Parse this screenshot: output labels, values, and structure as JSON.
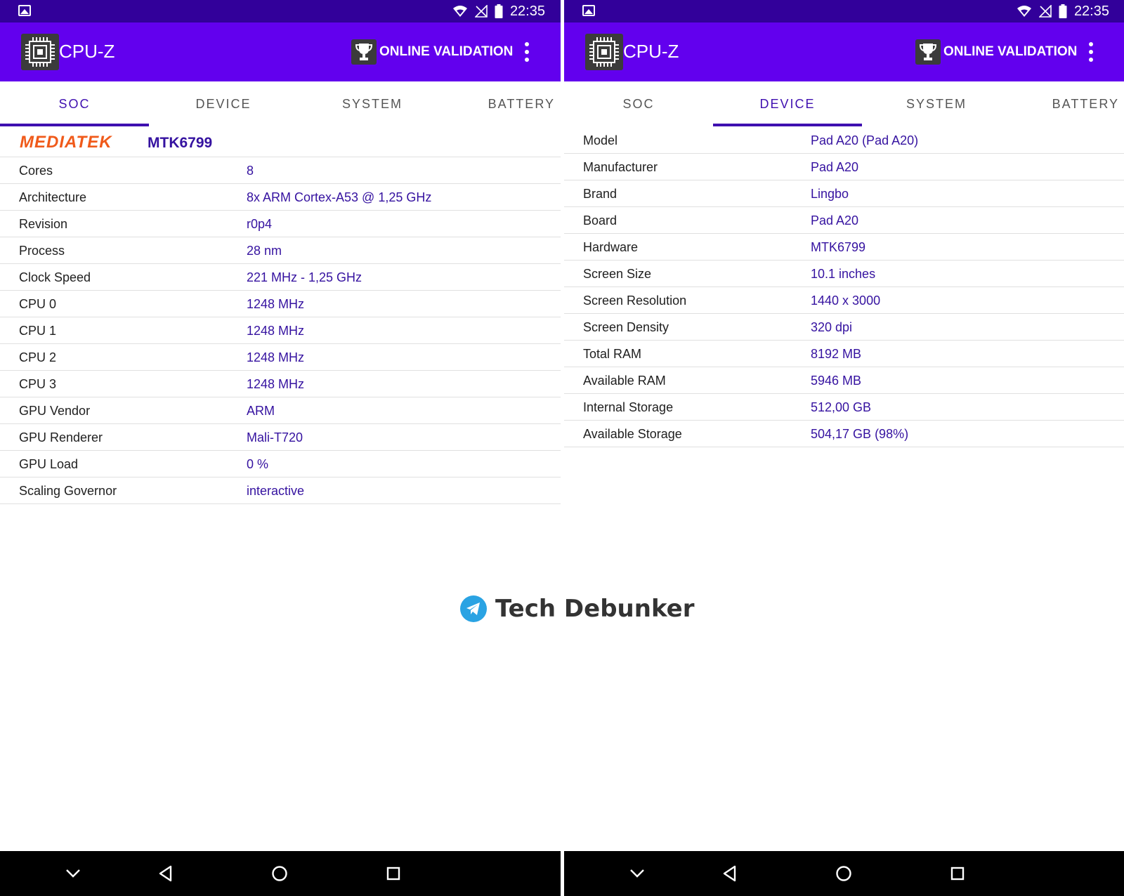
{
  "status_bar": {
    "time": "22:35"
  },
  "app": {
    "title": "CPU-Z",
    "validation_label": "ONLINE VALIDATION",
    "tabs": [
      "SOC",
      "DEVICE",
      "SYSTEM",
      "BATTERY"
    ],
    "accent": "#6200ee",
    "status_color": "#32009a",
    "value_color": "#3512a0"
  },
  "left": {
    "active_tab": "SOC",
    "vendor_logo": "MEDIATEK",
    "soc_name": "MTK6799",
    "rows": [
      {
        "label": "Cores",
        "value": "8"
      },
      {
        "label": "Architecture",
        "value": "8x ARM Cortex-A53 @ 1,25 GHz"
      },
      {
        "label": "Revision",
        "value": "r0p4"
      },
      {
        "label": "Process",
        "value": "28 nm"
      },
      {
        "label": "Clock Speed",
        "value": "221 MHz - 1,25 GHz"
      },
      {
        "label": "CPU 0",
        "value": "1248 MHz"
      },
      {
        "label": "CPU 1",
        "value": "1248 MHz"
      },
      {
        "label": "CPU 2",
        "value": "1248 MHz"
      },
      {
        "label": "CPU 3",
        "value": "1248 MHz"
      },
      {
        "label": "GPU Vendor",
        "value": "ARM"
      },
      {
        "label": "GPU Renderer",
        "value": "Mali-T720"
      },
      {
        "label": "GPU Load",
        "value": "0 %"
      },
      {
        "label": "Scaling Governor",
        "value": "interactive"
      }
    ]
  },
  "right": {
    "active_tab": "DEVICE",
    "rows": [
      {
        "label": "Model",
        "value": "Pad A20 (Pad A20)"
      },
      {
        "label": "Manufacturer",
        "value": "Pad A20"
      },
      {
        "label": "Brand",
        "value": "Lingbo"
      },
      {
        "label": "Board",
        "value": "Pad A20"
      },
      {
        "label": "Hardware",
        "value": "MTK6799"
      },
      {
        "label": "Screen Size",
        "value": "10.1 inches"
      },
      {
        "label": "Screen Resolution",
        "value": "1440 x 3000"
      },
      {
        "label": "Screen Density",
        "value": "320 dpi"
      },
      {
        "label": "Total RAM",
        "value": "8192 MB"
      },
      {
        "label": "Available RAM",
        "value": "5946 MB"
      },
      {
        "label": "Internal Storage",
        "value": "512,00 GB"
      },
      {
        "label": "Available Storage",
        "value": "504,17 GB (98%)"
      }
    ]
  },
  "watermark": {
    "text": "Tech Debunker",
    "icon": "telegram-icon"
  },
  "nav_icons": [
    "chevron-down-icon",
    "back-icon",
    "home-icon",
    "recents-icon"
  ]
}
